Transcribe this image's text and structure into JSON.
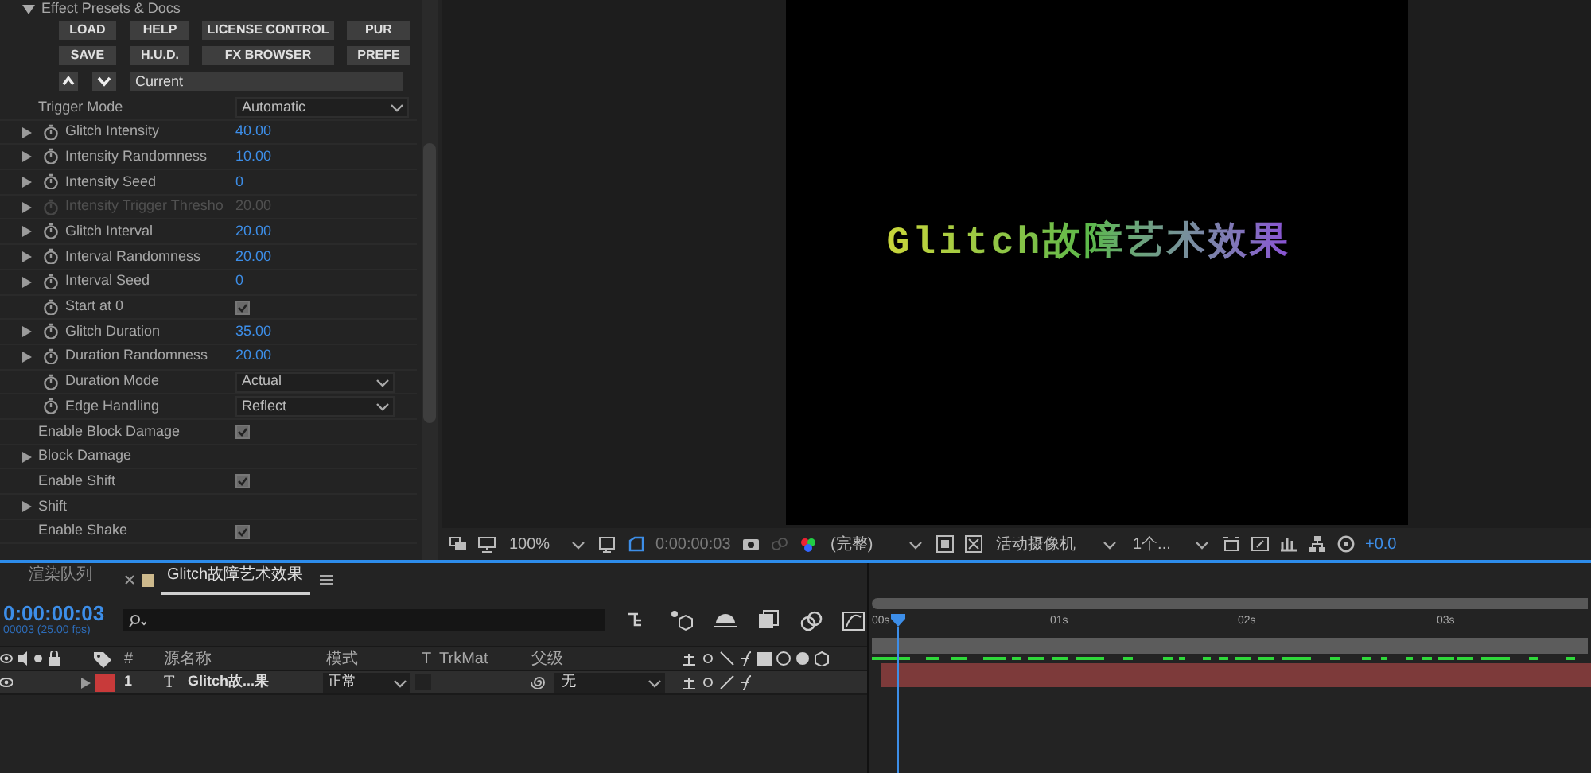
{
  "effect_panel": {
    "header": "Effect Presets & Docs",
    "expanded": true,
    "buttons": [
      [
        "LOAD",
        "HELP",
        "LICENSE CONTROL",
        "PUR"
      ],
      [
        "SAVE",
        "H.U.D.",
        "FX BROWSER",
        "PREFE"
      ]
    ],
    "preset_field": {
      "value": "Current"
    },
    "params": [
      {
        "kind": "dropdown",
        "label": "Trigger Mode",
        "value": "Automatic",
        "stopwatch": false,
        "expandable": false,
        "disabled": false
      },
      {
        "kind": "number",
        "label": "Glitch Intensity",
        "value": "40.00",
        "stopwatch": true,
        "expandable": true,
        "disabled": false
      },
      {
        "kind": "number",
        "label": "Intensity Randomness",
        "value": "10.00",
        "stopwatch": true,
        "expandable": true,
        "disabled": false
      },
      {
        "kind": "number",
        "label": "Intensity Seed",
        "value": "0",
        "stopwatch": true,
        "expandable": true,
        "disabled": false
      },
      {
        "kind": "number",
        "label": "Intensity Trigger Thresho",
        "value": "20.00",
        "stopwatch": true,
        "expandable": true,
        "disabled": true
      },
      {
        "kind": "number",
        "label": "Glitch Interval",
        "value": "20.00",
        "stopwatch": true,
        "expandable": true,
        "disabled": false
      },
      {
        "kind": "number",
        "label": "Interval Randomness",
        "value": "20.00",
        "stopwatch": true,
        "expandable": true,
        "disabled": false
      },
      {
        "kind": "number",
        "label": "Interval Seed",
        "value": "0",
        "stopwatch": true,
        "expandable": true,
        "disabled": false
      },
      {
        "kind": "checkbox",
        "label": "Start at 0",
        "checked": true,
        "stopwatch": true,
        "expandable": false,
        "disabled": false
      },
      {
        "kind": "number",
        "label": "Glitch Duration",
        "value": "35.00",
        "stopwatch": true,
        "expandable": true,
        "disabled": false
      },
      {
        "kind": "number",
        "label": "Duration Randomness",
        "value": "20.00",
        "stopwatch": true,
        "expandable": true,
        "disabled": false
      },
      {
        "kind": "dropdown",
        "label": "Duration Mode",
        "value": "Actual",
        "stopwatch": true,
        "expandable": false,
        "disabled": false
      },
      {
        "kind": "dropdown",
        "label": "Edge Handling",
        "value": "Reflect",
        "stopwatch": true,
        "expandable": false,
        "disabled": false
      },
      {
        "kind": "checkbox",
        "label": "Enable Block Damage",
        "checked": true,
        "stopwatch": false,
        "expandable": false,
        "disabled": false
      },
      {
        "kind": "group",
        "label": "Block Damage",
        "stopwatch": false,
        "expandable": true,
        "disabled": false
      },
      {
        "kind": "checkbox",
        "label": "Enable Shift",
        "checked": true,
        "stopwatch": false,
        "expandable": false,
        "disabled": false
      },
      {
        "kind": "group",
        "label": "Shift",
        "stopwatch": false,
        "expandable": true,
        "disabled": false
      },
      {
        "kind": "checkbox",
        "label": "Enable Shake",
        "checked": true,
        "stopwatch": false,
        "expandable": false,
        "disabled": false
      }
    ]
  },
  "composition": {
    "text": "Glitch故障艺术效果"
  },
  "viewer_toolbar": {
    "zoom": "100%",
    "timecode": "0:00:00:03",
    "resolution": "(完整)",
    "camera": "活动摄像机",
    "views": "1个...",
    "exposure": "+0.0"
  },
  "timeline": {
    "tabs": [
      {
        "label": "渲染队列",
        "selected": false,
        "closable": false
      },
      {
        "label": "Glitch故障艺术效果",
        "selected": true,
        "closable": true
      }
    ],
    "current_time": "0:00:00:03",
    "frame_info": "00003 (25.00 fps)",
    "columns": [
      "#",
      "源名称",
      "模式",
      "T",
      "TrkMat",
      "父级"
    ],
    "layers": [
      {
        "number": "1",
        "type": "T",
        "name": "Glitch故...果",
        "color": "#c83a3a",
        "mode": "正常",
        "parent": "无",
        "visible": true
      }
    ],
    "ruler": [
      "00s",
      "01s",
      "02s",
      "03s"
    ]
  }
}
